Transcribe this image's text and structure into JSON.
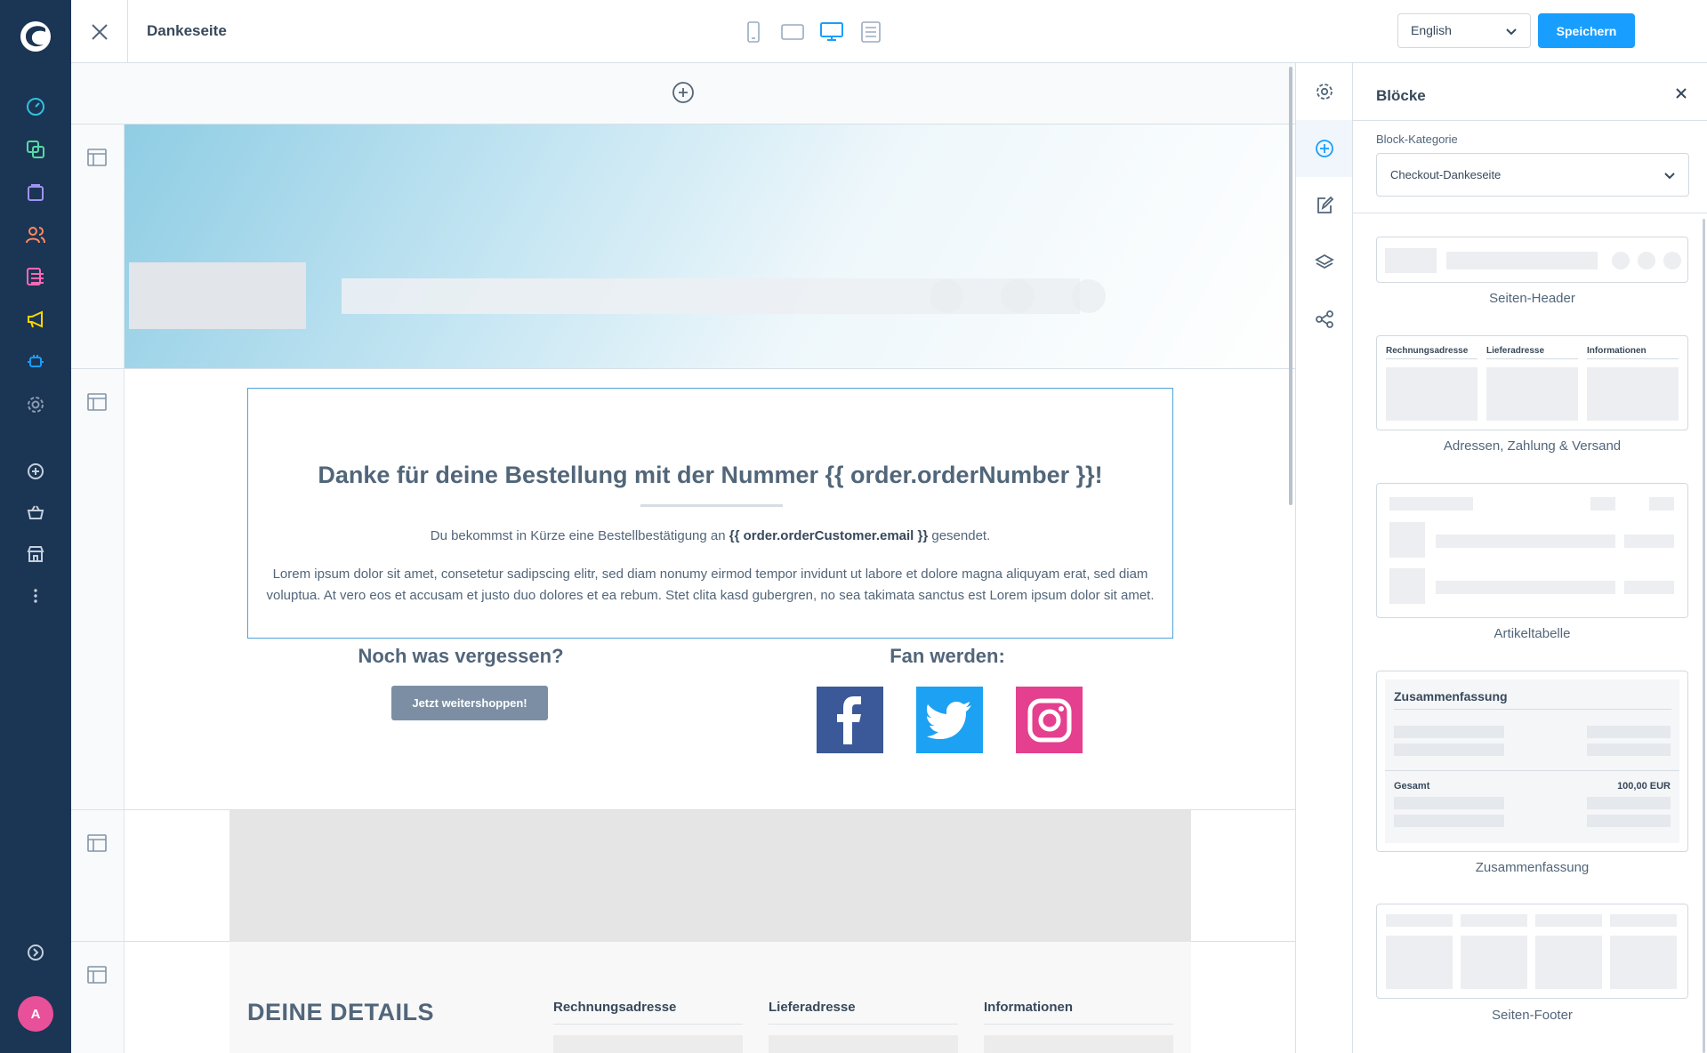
{
  "topbar": {
    "page_title": "Dankeseite",
    "language": "English",
    "save_label": "Speichern"
  },
  "user": {
    "avatar_initial": "A"
  },
  "hero": {},
  "thanks": {
    "headline": "Danke für deine Bestellung mit der Nummer {{ order.orderNumber }}!",
    "line_prefix": "Du bekommst in Kürze eine Bestellbestätigung an",
    "line_var": "{{ order.orderCustomer.email }}",
    "line_suffix": "gesendet.",
    "lorem": "Lorem ipsum dolor sit amet, consetetur sadipscing elitr, sed diam nonumy eirmod tempor invidunt ut labore et dolore magna aliquyam erat, sed diam voluptua. At vero eos et accusam et justo duo dolores et ea rebum. Stet clita kasd gubergren, no sea takimata sanctus est Lorem ipsum dolor sit amet.",
    "forgot_title": "Noch was vergessen?",
    "shop_button": "Jetzt weitershoppen!",
    "fan_title": "Fan werden:"
  },
  "details": {
    "title": "DEINE DETAILS",
    "columns": [
      "Rechnungsadresse",
      "Lieferadresse",
      "Informationen"
    ]
  },
  "panel": {
    "title": "Blöcke",
    "category_label": "Block-Kategorie",
    "category_value": "Checkout-Dankeseite",
    "cards": [
      {
        "label": "Seiten-Header"
      },
      {
        "label": "Adressen, Zahlung & Versand",
        "columns": [
          "Rechnungsadresse",
          "Lieferadresse",
          "Informationen"
        ]
      },
      {
        "label": "Artikeltabelle"
      },
      {
        "label": "Zusammenfassung",
        "heading": "Zusammenfassung",
        "total_label": "Gesamt",
        "total_value": "100,00 EUR"
      },
      {
        "label": "Seiten-Footer"
      }
    ]
  },
  "colors": {
    "sidebar": "#1b3554",
    "accent": "#189eff",
    "facebook": "#3b5998",
    "twitter": "#1da1f2",
    "instagram": "#e4408f"
  }
}
